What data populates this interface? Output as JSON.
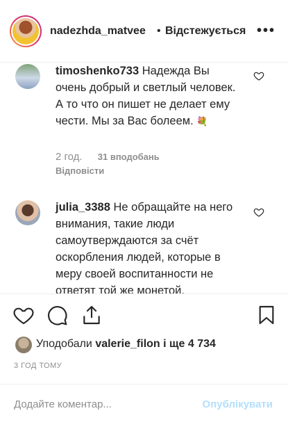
{
  "header": {
    "username": "nadezhda_matvee",
    "dot": "•",
    "follow_status": "Відстежується",
    "more": "•••"
  },
  "comments": [
    {
      "username": "timoshenko733",
      "text": "Надежда Вы очень добрый и светлый человек. А то что он пишет не делает ему чести. Мы за Вас болеем.",
      "emoji": "💐",
      "time": "2 год.",
      "likes": "31 вподобань",
      "reply": "Відповісти"
    },
    {
      "username": "julia_3388",
      "text": "Не обращайте на него внимания, такие люди самоутверждаются за счёт оскорбления людей, которые в меру своей воспитанности не ответят той же монетой."
    }
  ],
  "likes_row": {
    "prefix": "Уподобали",
    "user": "valerie_filon",
    "middle": "і ще",
    "count": "4 734"
  },
  "timestamp": "3 ГОД ТОМУ",
  "add_comment": {
    "placeholder": "Додайте коментар...",
    "post_label": "Опублікувати"
  },
  "colors": {
    "text": "#262626",
    "muted": "#8e8e8e",
    "post_disabled": "#b2dffc"
  }
}
